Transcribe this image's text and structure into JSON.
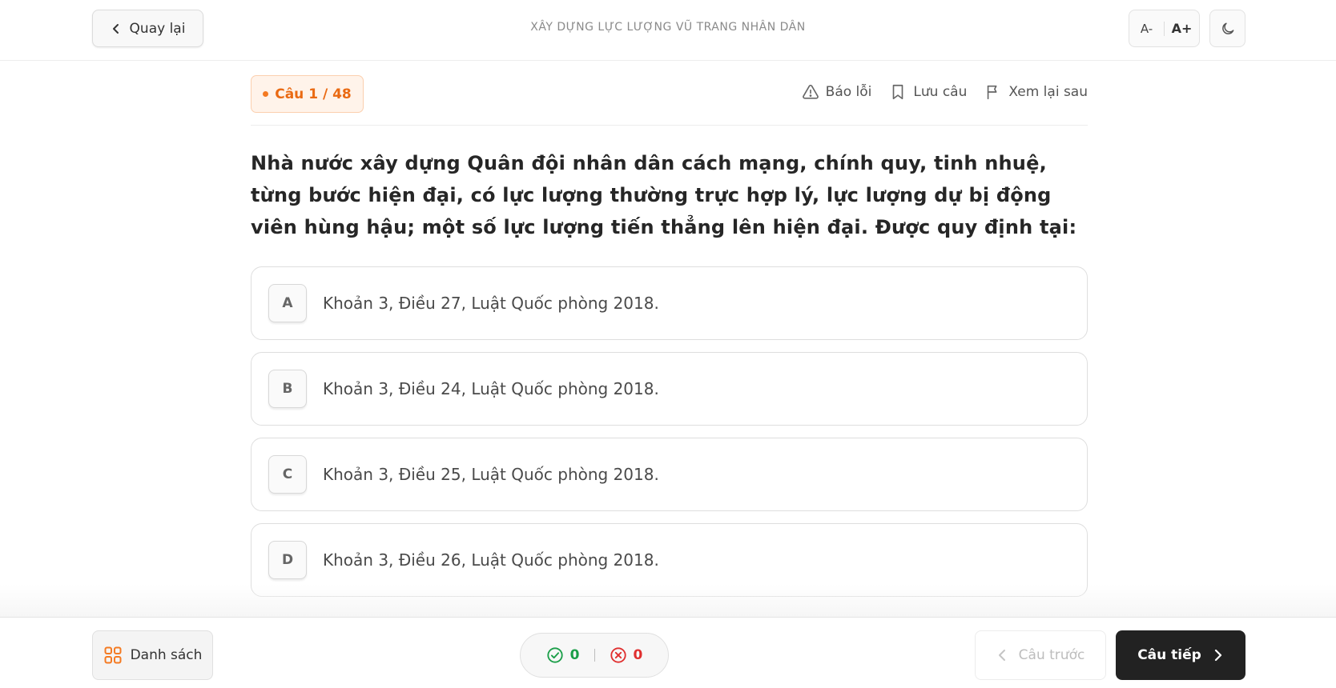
{
  "header": {
    "back_label": "Quay lại",
    "title": "XÂY DỰNG LỰC LƯỢNG VŨ TRANG NHÂN DÂN",
    "font_decrease": "A-",
    "font_increase": "A+",
    "theme_icon": "moon-icon"
  },
  "question_meta": {
    "counter": "Câu 1 / 48",
    "actions": {
      "report": "Báo lỗi",
      "save": "Lưu câu",
      "review": "Xem lại sau"
    }
  },
  "question": {
    "text": "Nhà nước xây dựng Quân đội nhân dân cách mạng, chính quy, tinh nhuệ, từng bước hiện đại, có lực lượng thường trực hợp lý, lực lượng dự bị động viên hùng hậu; một số lực lượng tiến thẳng lên hiện đại. Được quy định tại:"
  },
  "options": [
    {
      "letter": "A",
      "text": "Khoản 3, Điều 27, Luật Quốc phòng 2018."
    },
    {
      "letter": "B",
      "text": "Khoản 3, Điều 24, Luật Quốc phòng 2018."
    },
    {
      "letter": "C",
      "text": "Khoản 3, Điều 25, Luật Quốc phòng 2018."
    },
    {
      "letter": "D",
      "text": "Khoản 3, Điều 26, Luật Quốc phòng 2018."
    }
  ],
  "footer": {
    "list_label": "Danh sách",
    "correct_count": "0",
    "wrong_count": "0",
    "prev_label": "Câu trước",
    "next_label": "Câu tiếp"
  },
  "colors": {
    "accent_orange": "#ea6a13",
    "correct_green": "#1a9e48",
    "wrong_red": "#e02f2f",
    "primary_dark": "#222222"
  }
}
